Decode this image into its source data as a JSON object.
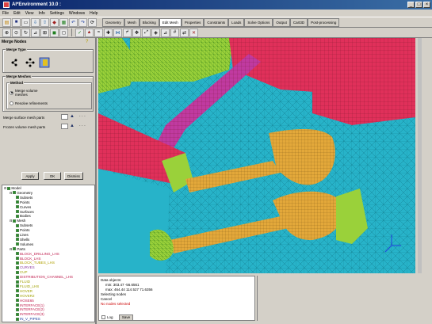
{
  "window": {
    "title": "AI*Environment 10.0 :"
  },
  "menu": [
    "File",
    "Edit",
    "View",
    "Info",
    "Settings",
    "Windows",
    "Help"
  ],
  "tabs": [
    "Geometry",
    "Mesh",
    "Blocking",
    "Edit Mesh",
    "Properties",
    "Constraints",
    "Loads",
    "Solve Options",
    "Output",
    "Cart3D",
    "Post-processing"
  ],
  "active_tab": "Edit Mesh",
  "panel": {
    "title": "Merge Nodes",
    "merge_type_label": "Merge Type",
    "merge_meshes_label": "Merge Meshes",
    "method_label": "Method",
    "options": [
      "Merge volume meshes",
      "Resolve refinements"
    ],
    "selected_option": "Merge volume meshes",
    "fields": [
      "Merge surface mesh parts",
      "Frozen volume mesh parts"
    ],
    "buttons": [
      "Apply",
      "OK",
      "Dismiss"
    ]
  },
  "tree": [
    {
      "label": "Model",
      "indent": 0
    },
    {
      "label": "Geometry",
      "indent": 1
    },
    {
      "label": "Subsets",
      "indent": 2
    },
    {
      "label": "Points",
      "indent": 2
    },
    {
      "label": "Curves",
      "indent": 2
    },
    {
      "label": "Surfaces",
      "indent": 2
    },
    {
      "label": "Bodies",
      "indent": 2
    },
    {
      "label": "Mesh",
      "indent": 1
    },
    {
      "label": "Subsets",
      "indent": 2
    },
    {
      "label": "Points",
      "indent": 2
    },
    {
      "label": "Lines",
      "indent": 2
    },
    {
      "label": "Shells",
      "indent": 2
    },
    {
      "label": "Volumes",
      "indent": 2
    },
    {
      "label": "Parts",
      "indent": 1
    },
    {
      "label": "BLOCK_DRILLING_LHS",
      "indent": 2,
      "color": "#c02050"
    },
    {
      "label": "BLOCK_LHS",
      "indent": 2,
      "color": "#c02050"
    },
    {
      "label": "BLOCK_TUBES_LHS",
      "indent": 2,
      "color": "#b0a000"
    },
    {
      "label": "CURVES",
      "indent": 2,
      "color": "#9040a0"
    },
    {
      "label": "CUP",
      "indent": 2,
      "color": "#a0a000"
    },
    {
      "label": "DISTRIBUTION_CHANNEL_LHS",
      "indent": 2,
      "color": "#c02050"
    },
    {
      "label": "FLUID",
      "indent": 2,
      "color": "#a0a000"
    },
    {
      "label": "FLUID_LHS",
      "indent": 2,
      "color": "#a0a000"
    },
    {
      "label": "HOVER",
      "indent": 2,
      "color": "#a0a000"
    },
    {
      "label": "HOVER2",
      "indent": 2,
      "color": "#a0a000"
    },
    {
      "label": "HOSE65",
      "indent": 2,
      "color": "#c02050"
    },
    {
      "label": "INTERFACE(1)",
      "indent": 2,
      "color": "#c02050"
    },
    {
      "label": "INTERFACE(2)",
      "indent": 2,
      "color": "#c02050"
    },
    {
      "label": "INTERFACE(3)",
      "indent": 2,
      "color": "#c02050"
    },
    {
      "label": "IN_V_PIPES",
      "indent": 2,
      "color": "#2040a0"
    }
  ],
  "messages": [
    "Data objects:",
    "min: 303.47 -56.6561",
    "max: 464.44 114.527 71.6356",
    "Selecting nodes",
    "Cancel",
    "No nodes selected"
  ],
  "log": {
    "label": "Log",
    "save": "Save"
  },
  "colors": {
    "fluid": "#27b3c9",
    "mesh_green": "#9ad13a",
    "mesh_red": "#e0305a",
    "mesh_purple": "#c03aa0",
    "mesh_orange": "#e3a83a"
  }
}
